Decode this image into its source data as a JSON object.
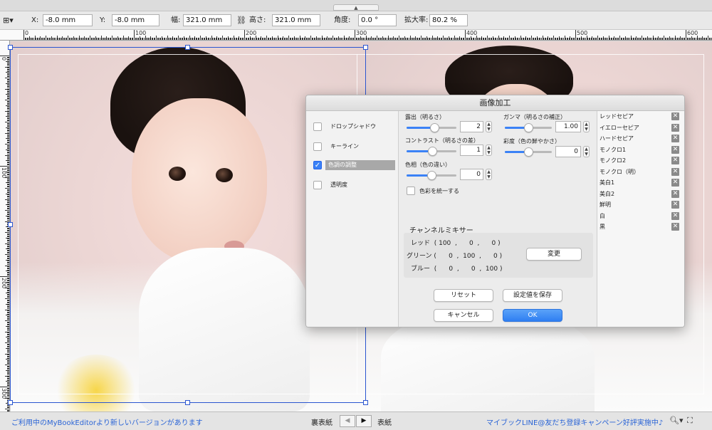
{
  "toolbar": {
    "x_label": "X:",
    "x_value": "-8.0 mm",
    "y_label": "Y:",
    "y_value": "-8.0 mm",
    "width_label": "幅:",
    "width_value": "321.0 mm",
    "height_label": "高さ:",
    "height_value": "321.0 mm",
    "angle_label": "角度:",
    "angle_value": "0.0 °",
    "zoom_label": "拡大率:",
    "zoom_value": "80.2 %"
  },
  "ruler": {
    "h_labels": [
      "0",
      "100",
      "200",
      "300",
      "400",
      "500",
      "600"
    ],
    "v_labels": [
      "0",
      "100",
      "200",
      "300"
    ]
  },
  "dialog": {
    "title": "画像加工",
    "options": [
      {
        "label": "ドロップシャドウ",
        "checked": false
      },
      {
        "label": "キーライン",
        "checked": false
      },
      {
        "label": "色調の調整",
        "checked": true
      },
      {
        "label": "透明度",
        "checked": false
      }
    ],
    "adjustments": {
      "exposure": {
        "label": "露出（明るさ）",
        "value": "2",
        "level": 0.55
      },
      "gamma": {
        "label": "ガンマ（明るさの補正）",
        "value": "1.00",
        "level": 0.5
      },
      "contrast": {
        "label": "コントラスト（明るさの差）",
        "value": "1",
        "level": 0.52
      },
      "saturation": {
        "label": "彩度（色の鮮やかさ）",
        "value": "0",
        "level": 0.5
      },
      "hue": {
        "label": "色相（色の違い）",
        "value": "0",
        "level": 0.5
      },
      "unify_color": {
        "label": "色彩を統一する",
        "checked": false
      }
    },
    "mixer": {
      "title": "チャンネルミキサー",
      "rows": [
        "レッド  ( 100  ,      0  ,      0 )",
        "グリーン (      0  ,  100  ,      0 )",
        "ブルー  (      0  ,      0  ,  100 )"
      ],
      "change_button": "変更"
    },
    "buttons": {
      "reset": "リセット",
      "save": "設定値を保存",
      "cancel": "キャンセル",
      "ok": "OK"
    },
    "presets": [
      "レッドセピア",
      "イエローセピア",
      "ハードセピア",
      "モノクロ1",
      "モノクロ2",
      "モノクロ（明）",
      "美白1",
      "美白2",
      "鮮明",
      "白",
      "黒"
    ]
  },
  "statusbar": {
    "update_notice": "ご利用中のMyBookEditorより新しいバージョンがあります",
    "back_cover": "裏表紙",
    "front_cover": "表紙",
    "campaign": "マイブックLINE@友だち登録キャンペーン好評実施中♪"
  },
  "colors": {
    "accent": "#2f7ff2",
    "selection": "#2a55d0",
    "link": "#2a64d6"
  }
}
